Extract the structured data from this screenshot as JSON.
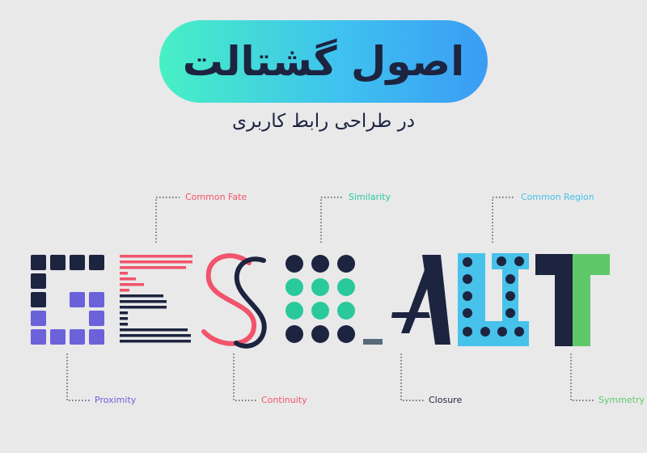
{
  "title": "اصول گشتالت",
  "subtitle": "در طراحی رابط کاربری",
  "labels": {
    "common_fate": "Common Fate",
    "similarity": "Similarity",
    "common_region": "Common Region",
    "proximity": "Proximity",
    "continuity": "Continuity",
    "closure": "Closure",
    "symmetry": "Symmetry"
  },
  "colors": {
    "navy": "#1d2440",
    "purple": "#6b61d8",
    "red": "#f1546b",
    "teal": "#29c99c",
    "sky": "#47c2ea",
    "green": "#5fc96a",
    "slate": "#566a7a"
  }
}
